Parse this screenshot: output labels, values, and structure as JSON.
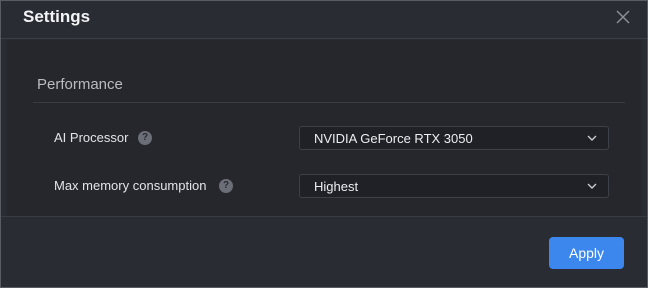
{
  "dialog": {
    "title": "Settings",
    "close_icon": "close-icon"
  },
  "performance": {
    "section_title": "Performance",
    "ai_processor": {
      "label": "AI Processor",
      "help_icon": "help-icon",
      "value": "NVIDIA GeForce RTX 3050"
    },
    "max_memory": {
      "label": "Max memory consumption",
      "help_icon": "help-icon",
      "value": "Highest"
    }
  },
  "footer": {
    "apply_label": "Apply"
  },
  "colors": {
    "background": "#2a2c33",
    "accent": "#3c87ee"
  }
}
